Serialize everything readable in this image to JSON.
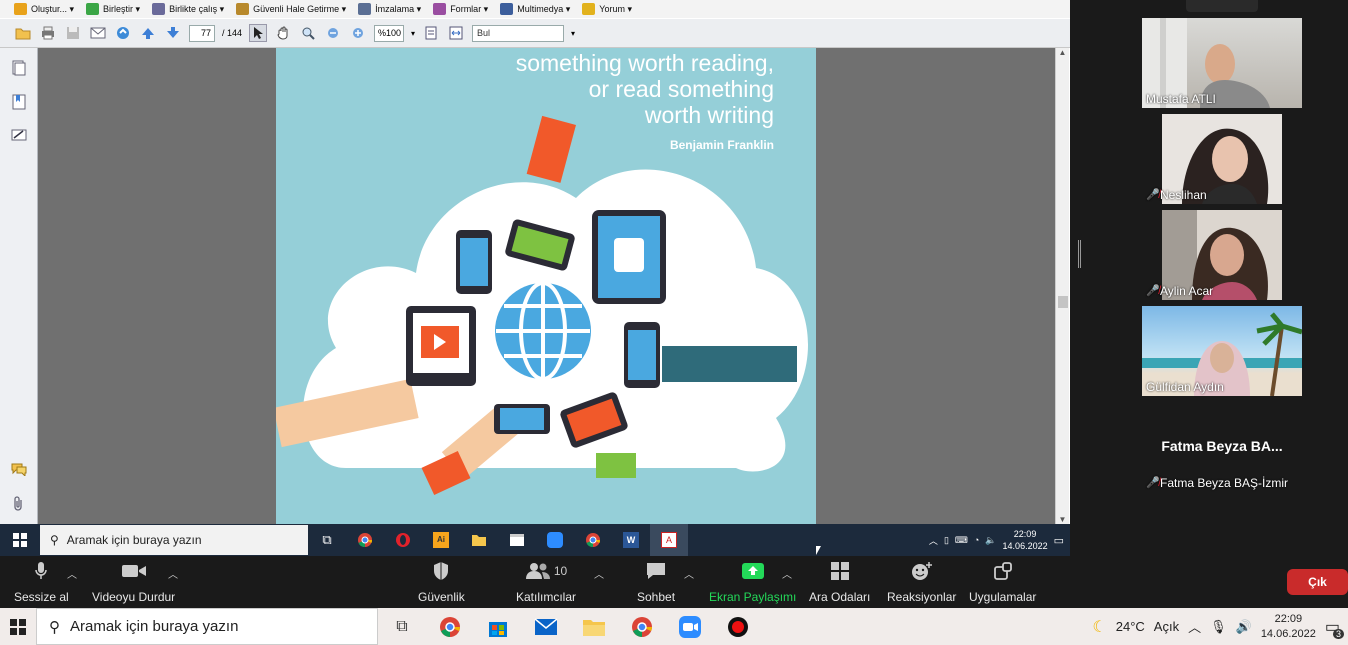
{
  "menubar": {
    "items": [
      {
        "label": "Oluştur... ▾",
        "icon": "create-icon",
        "color": "#e8a21b"
      },
      {
        "label": "Birleştir ▾",
        "icon": "combine-icon",
        "color": "#3ba646"
      },
      {
        "label": "Birlikte çalış ▾",
        "icon": "collaborate-icon",
        "color": "#6a6a9a"
      },
      {
        "label": "Güvenli Hale Getirme ▾",
        "icon": "lock-icon",
        "color": "#b8892c"
      },
      {
        "label": "İmzalama ▾",
        "icon": "pen-icon",
        "color": "#5b6f94"
      },
      {
        "label": "Formlar ▾",
        "icon": "form-icon",
        "color": "#9a4ea1"
      },
      {
        "label": "Multimedya ▾",
        "icon": "multimedia-icon",
        "color": "#3c5e9c"
      },
      {
        "label": "Yorum ▾",
        "icon": "comment-icon",
        "color": "#e2b21d"
      }
    ]
  },
  "toolbar": {
    "page_current": "77",
    "page_total": "/ 144",
    "zoom": "%100",
    "find_placeholder": "Bul"
  },
  "document": {
    "quote_line1": "something worth reading,",
    "quote_line2": "or read something",
    "quote_line3": "worth writing",
    "author": "Benjamin Franklin"
  },
  "taskbar1": {
    "search_placeholder": "Aramak için buraya yazın",
    "time": "22:09",
    "date": "14.06.2022"
  },
  "participants": [
    {
      "name": "Mustafa ATLI",
      "muted": false
    },
    {
      "name": "Neslihan",
      "muted": true
    },
    {
      "name": "Aylin Acar",
      "muted": true
    },
    {
      "name": "Gülfidan Aydın",
      "muted": false
    },
    {
      "name": "Fatma Beyza BAŞ-İzmir",
      "muted": true,
      "display_short": "Fatma Beyza BA..."
    }
  ],
  "zoom_controls": {
    "mute_label": "Sessize al",
    "video_label": "Videoyu Durdur",
    "security_label": "Güvenlik",
    "participants_label": "Katılımcılar",
    "participants_count": "10",
    "chat_label": "Sohbet",
    "share_label": "Ekran Paylaşımı",
    "breakout_label": "Ara Odaları",
    "reactions_label": "Reaksiyonlar",
    "apps_label": "Uygulamalar",
    "leave_label": "Çık",
    "share_color": "#23d959",
    "leave_color": "#c92b2b"
  },
  "taskbar2": {
    "search_placeholder": "Aramak için buraya yazın",
    "weather": "24°C",
    "weather_desc": "Açık",
    "time": "22:09",
    "date": "14.06.2022",
    "notifications": "3"
  }
}
